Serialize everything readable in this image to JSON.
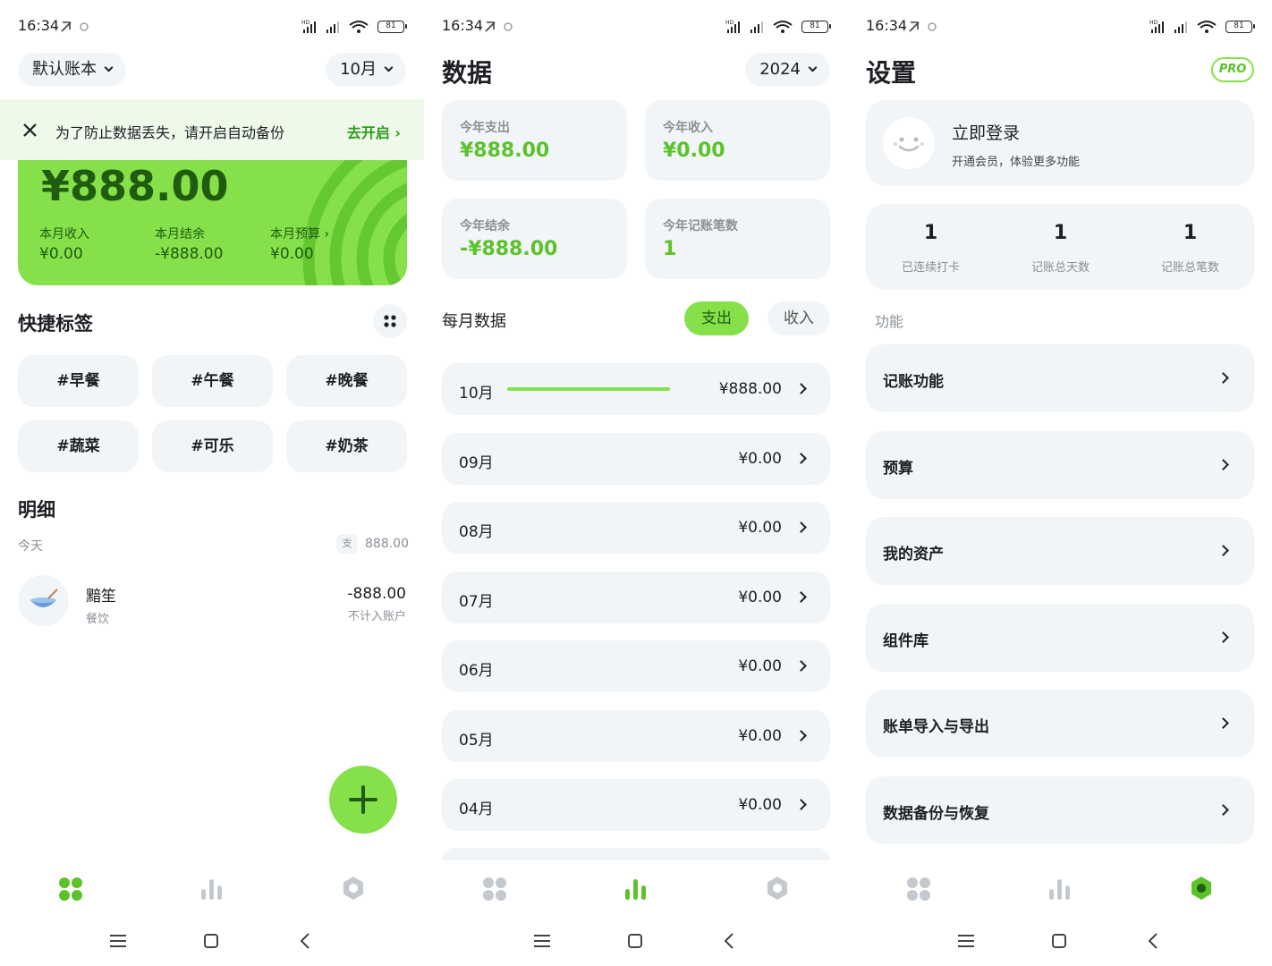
{
  "colors": {
    "accent": "#86e04a",
    "accent_dark": "#2e9b1a",
    "value_green": "#5bc22a",
    "card_bg": "#f2f5f7",
    "nav_inactive": "#c4c9cf"
  },
  "status": {
    "time": "16:34",
    "battery": "81"
  },
  "home": {
    "book_label": "默认账本",
    "month_label": "10月",
    "banner": {
      "message": "为了防止数据丢失，请开启自动备份",
      "action": "去开启"
    },
    "balance": "¥888.00",
    "stats": [
      {
        "label": "本月收入",
        "value": "¥0.00"
      },
      {
        "label": "本月结余",
        "value": "-¥888.00"
      },
      {
        "label": "本月预算",
        "value": "¥0.00"
      }
    ],
    "quick_tags_title": "快捷标签",
    "tags": [
      "#早餐",
      "#午餐",
      "#晚餐",
      "#蔬菜",
      "#可乐",
      "#奶茶"
    ],
    "detail_title": "明细",
    "day_label": "今天",
    "day_badge": "支",
    "day_total": "888.00",
    "transaction": {
      "name": "黯笙",
      "category": "餐饮",
      "amount": "-888.00",
      "note": "不计入账户"
    }
  },
  "data_page": {
    "title": "数据",
    "year": "2024",
    "cards": [
      {
        "label": "今年支出",
        "value": "¥888.00"
      },
      {
        "label": "今年收入",
        "value": "¥0.00"
      },
      {
        "label": "今年结余",
        "value": "-¥888.00"
      },
      {
        "label": "今年记账笔数",
        "value": "1"
      }
    ],
    "monthly_title": "每月数据",
    "toggle_expense": "支出",
    "toggle_income": "收入",
    "months": [
      {
        "month": "10月",
        "amount": "¥888.00",
        "progress": 1.0
      },
      {
        "month": "09月",
        "amount": "¥0.00",
        "progress": 0
      },
      {
        "month": "08月",
        "amount": "¥0.00",
        "progress": 0
      },
      {
        "month": "07月",
        "amount": "¥0.00",
        "progress": 0
      },
      {
        "month": "06月",
        "amount": "¥0.00",
        "progress": 0
      },
      {
        "month": "05月",
        "amount": "¥0.00",
        "progress": 0
      },
      {
        "month": "04月",
        "amount": "¥0.00",
        "progress": 0
      }
    ]
  },
  "settings": {
    "title": "设置",
    "pro_badge": "PRO",
    "login_title": "立即登录",
    "login_subtitle": "开通会员，体验更多功能",
    "stats": [
      {
        "value": "1",
        "label": "已连续打卡"
      },
      {
        "value": "1",
        "label": "记账总天数"
      },
      {
        "value": "1",
        "label": "记账总笔数"
      }
    ],
    "section_label": "功能",
    "items": [
      "记账功能",
      "预算",
      "我的资产",
      "组件库",
      "账单导入与导出",
      "数据备份与恢复"
    ]
  },
  "nav": {
    "icons": [
      "dashboard-icon",
      "chart-icon",
      "settings-icon"
    ]
  }
}
